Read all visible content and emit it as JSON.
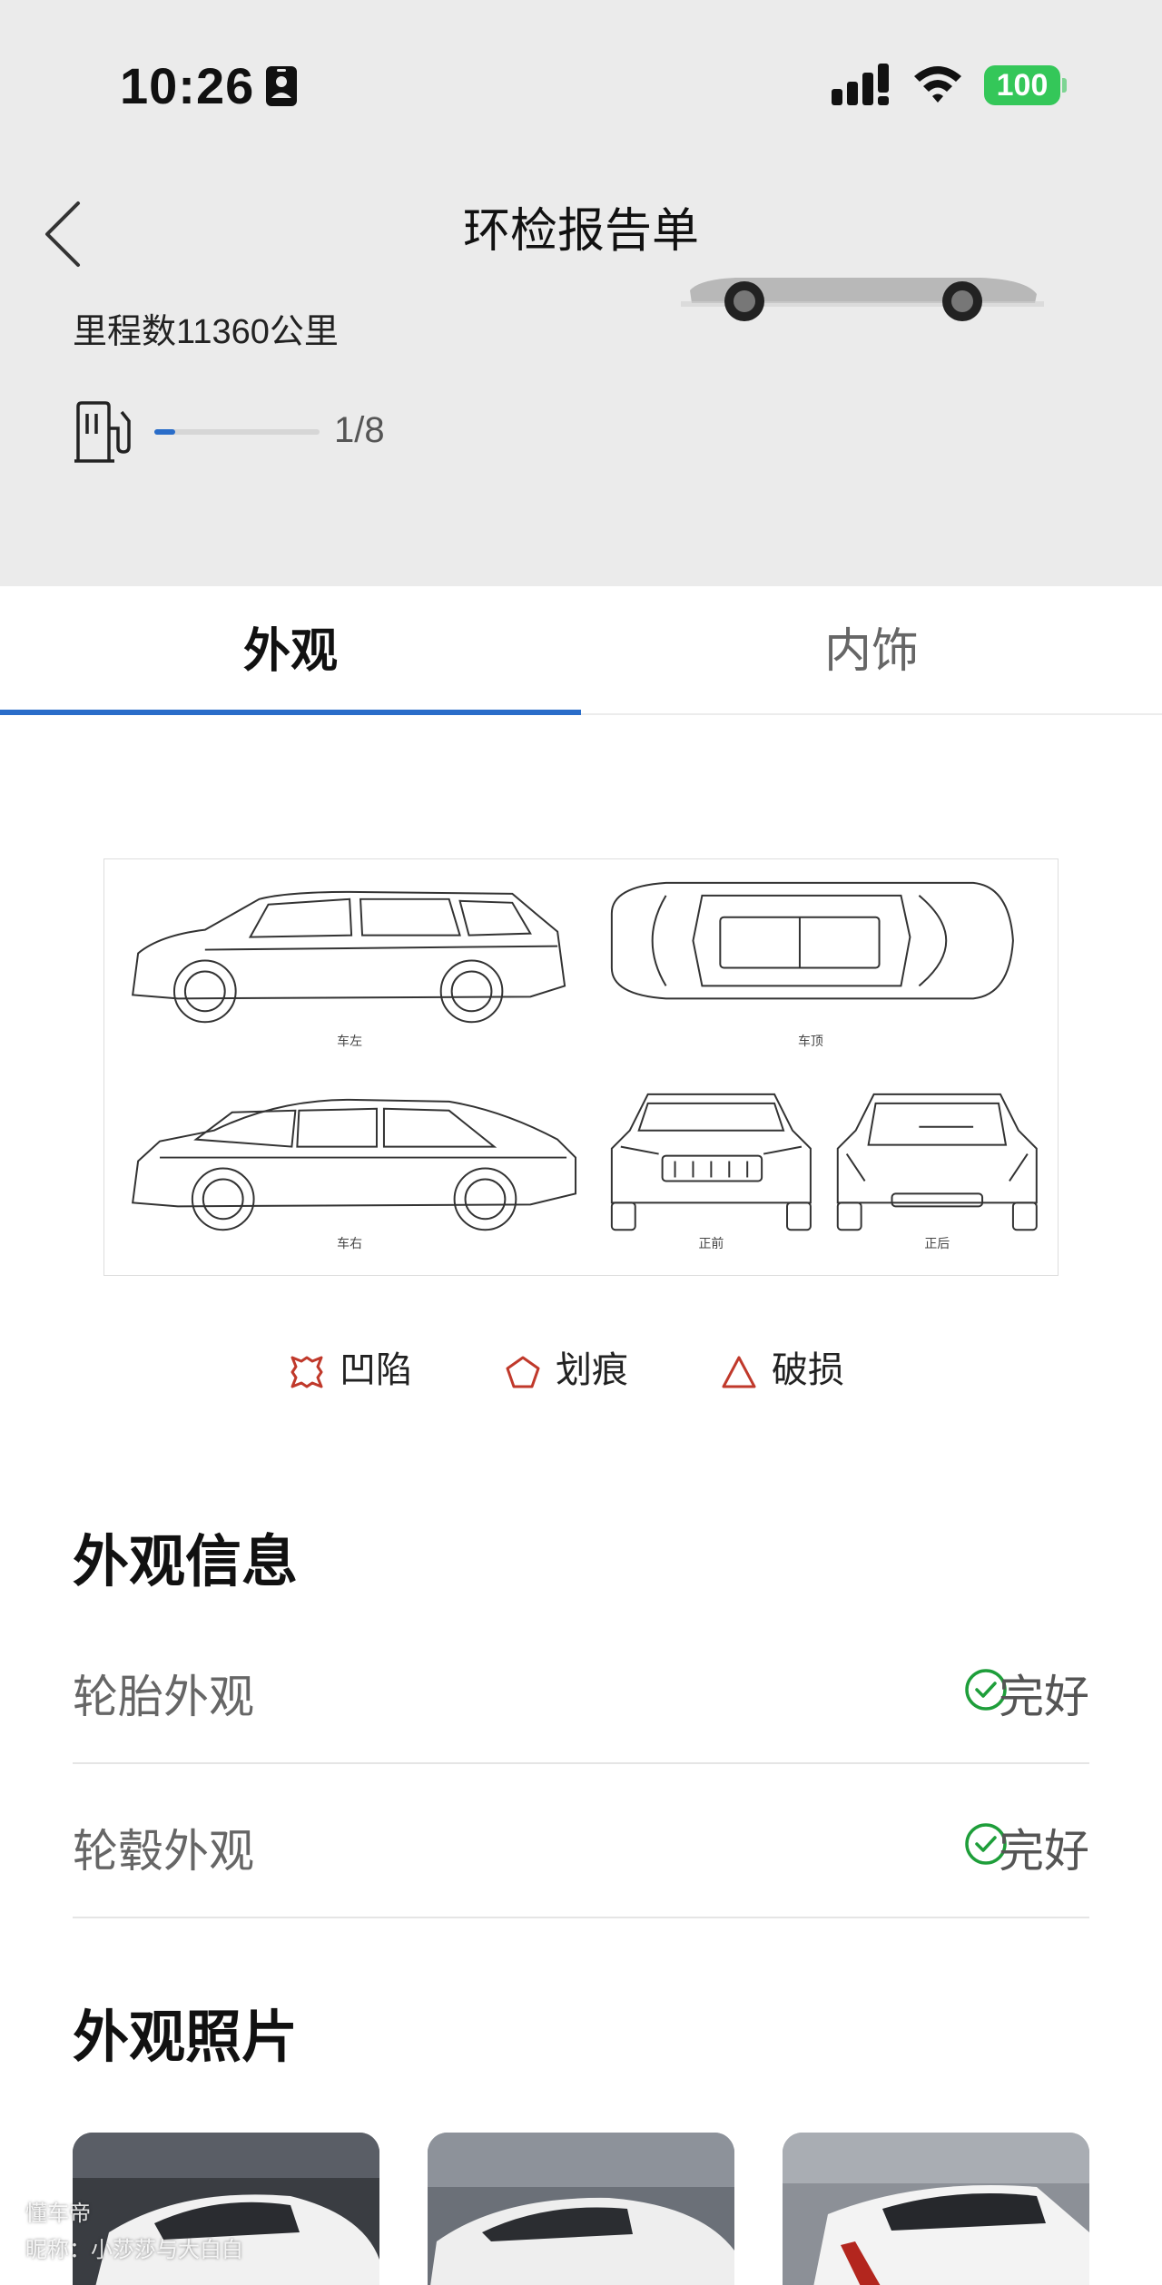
{
  "status_bar": {
    "time": "10:26",
    "battery": "100",
    "battery_color": "#34c759"
  },
  "nav": {
    "title": "环检报告单",
    "back_icon": "chevron-left-icon"
  },
  "vehicle": {
    "mileage": "里程数11360公里",
    "fuel_level": 0.125,
    "fuel_text": "1/8"
  },
  "tabs": [
    {
      "label": "外观",
      "active": true
    },
    {
      "label": "内饰",
      "active": false
    }
  ],
  "accent_color": "#2a6dc9",
  "diagram": {
    "views": [
      "车左",
      "车顶",
      "车右",
      "正前",
      "正后"
    ]
  },
  "legend": [
    {
      "icon": "dent-icon",
      "label": "凹陷"
    },
    {
      "icon": "scratch-icon",
      "label": "划痕"
    },
    {
      "icon": "damage-icon",
      "label": "破损"
    }
  ],
  "legend_color": "#c0392b",
  "exterior_info": {
    "title": "外观信息",
    "rows": [
      {
        "label": "轮胎外观",
        "status": "完好"
      },
      {
        "label": "轮毂外观",
        "status": "完好"
      }
    ],
    "ok_color": "#1e9e3a"
  },
  "exterior_photos": {
    "title": "外观照片"
  },
  "watermark": {
    "brand": "懂车帝",
    "author": "昵称：小莎莎与大白白"
  }
}
